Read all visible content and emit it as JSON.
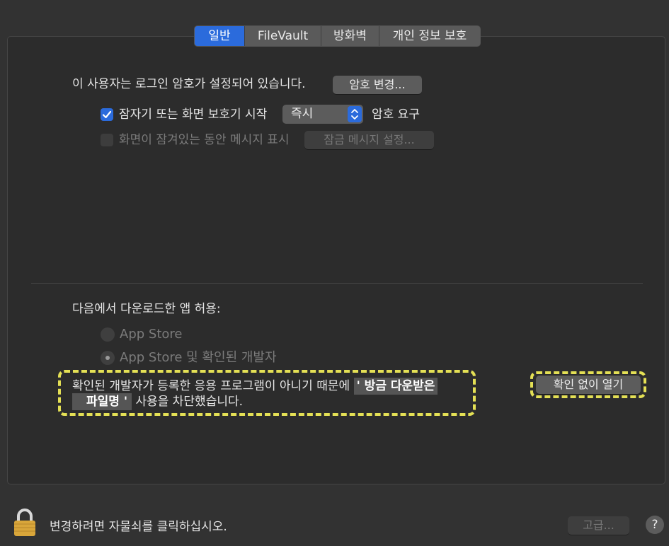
{
  "tabs": [
    {
      "label": "일반",
      "active": true
    },
    {
      "label": "FileVault",
      "active": false
    },
    {
      "label": "방화벽",
      "active": false
    },
    {
      "label": "개인 정보 보호",
      "active": false
    }
  ],
  "password": {
    "text": "이 사용자는 로그인 암호가 설정되어 있습니다.",
    "change_button": "암호 변경..."
  },
  "require_password": {
    "checked": true,
    "label": "잠자기 또는 화면 보호기 시작",
    "select_value": "즉시",
    "suffix": "암호 요구"
  },
  "lock_message": {
    "checked": false,
    "label": "화면이 잠겨있는 동안 메시지 표시",
    "button": "잠금 메시지 설정..."
  },
  "downloads": {
    "heading": "다음에서 다운로드한 앱 허용:",
    "options": [
      {
        "label": "App Store",
        "selected": false
      },
      {
        "label": "App Store 및 확인된 개발자",
        "selected": true
      }
    ]
  },
  "blocked": {
    "text_before": "확인된 개발자가 등록한 응용 프로그램이 아니기 때문에",
    "name_part1": "' 방금 다운받은",
    "name_part2": "파일명 '",
    "text_after": "사용을 차단했습니다.",
    "open_anyway_button": "확인 없이 열기"
  },
  "footer": {
    "lock_text": "변경하려면 자물쇠를 클릭하십시오.",
    "advanced_button": "고급...",
    "help_label": "?"
  },
  "colors": {
    "accent": "#2b6bdc",
    "highlight": "#e4e055",
    "background": "#323232"
  }
}
